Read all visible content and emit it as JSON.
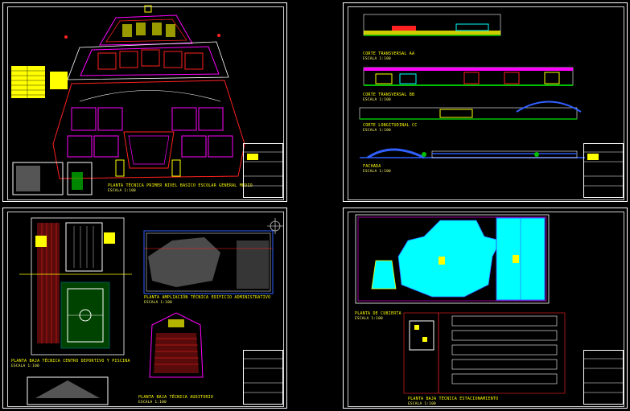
{
  "colors": {
    "background": "#000000",
    "frame": "#ffffff",
    "label": "#ffff00",
    "magenta": "#ff00ff",
    "red": "#ff2020",
    "cyan": "#00ffff",
    "green": "#00c000",
    "blue": "#3060ff"
  },
  "sheets": [
    {
      "name": "top-left",
      "labels": [
        {
          "text": "PLANTA TÉCNICA PRIMER NIVEL BASICO ESCOLAR GENERAL MEDIO",
          "scale": "ESCALA 1:100"
        }
      ]
    },
    {
      "name": "top-right",
      "labels": [
        {
          "text": "CORTE TRANSVERSAL AA",
          "scale": "ESCALA 1:100"
        },
        {
          "text": "CORTE TRANSVERSAL BB",
          "scale": "ESCALA 1:100"
        },
        {
          "text": "CORTE LONGITUDINAL CC",
          "scale": "ESCALA 1:100"
        },
        {
          "text": "FACHADA",
          "scale": "ESCALA 1:100"
        }
      ]
    },
    {
      "name": "bottom-left",
      "labels": [
        {
          "text": "PLANTA BAJA TÉCNICA CENTRO DEPORTIVO Y PISCINA",
          "scale": "ESCALA 1:100"
        },
        {
          "text": "PLANTA AMPLIACIÓN TÉCNICA EDIFICIO ADMINISTRATIVO",
          "scale": "ESCALA 1:100"
        },
        {
          "text": "PLANTA BAJA TÉCNICA AUDITORIO",
          "scale": "ESCALA 1:100"
        }
      ]
    },
    {
      "name": "bottom-right",
      "labels": [
        {
          "text": "PLANTA DE CUBIERTA",
          "scale": "ESCALA 1:100"
        },
        {
          "text": "PLANTA BAJA TÉCNICA ESTACIONAMIENTO",
          "scale": "ESCALA 1:100"
        }
      ]
    }
  ]
}
